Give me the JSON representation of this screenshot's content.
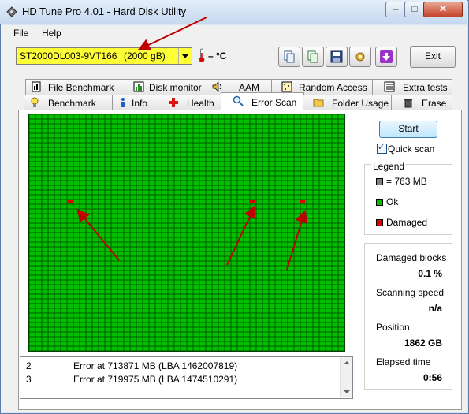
{
  "window": {
    "title": "HD Tune Pro 4.01 - Hard Disk Utility"
  },
  "menu": {
    "file": "File",
    "help": "Help"
  },
  "drive": {
    "name": "ST2000DL003-9VT166",
    "capacity": "(2000 gB)"
  },
  "temperature": "– °C",
  "toolbar": {
    "icons": [
      "copy-icon",
      "copy-all-icon",
      "save-icon",
      "options-icon",
      "download-icon"
    ],
    "exit_label": "Exit"
  },
  "tabs_row1": [
    {
      "label": "File Benchmark",
      "icon": "file-benchmark-icon"
    },
    {
      "label": "Disk monitor",
      "icon": "disk-monitor-icon"
    },
    {
      "label": "AAM",
      "icon": "speaker-icon"
    },
    {
      "label": "Random Access",
      "icon": "random-access-icon"
    },
    {
      "label": "Extra tests",
      "icon": "extra-tests-icon"
    }
  ],
  "tabs_row2": [
    {
      "label": "Benchmark",
      "icon": "bulb-icon"
    },
    {
      "label": "Info",
      "icon": "info-icon"
    },
    {
      "label": "Health",
      "icon": "health-cross-icon"
    },
    {
      "label": "Error Scan",
      "icon": "magnifier-icon",
      "active": true
    },
    {
      "label": "Folder Usage",
      "icon": "folder-icon"
    },
    {
      "label": "Erase",
      "icon": "trash-icon"
    }
  ],
  "scan": {
    "start_label": "Start",
    "quick_scan_label": "Quick scan",
    "quick_scan_checked": true
  },
  "legend": {
    "title": "Legend",
    "block_size": "= 763 MB",
    "ok": "Ok",
    "damaged": "Damaged"
  },
  "stats": {
    "damaged_blocks_label": "Damaged blocks",
    "damaged_blocks_value": "0.1 %",
    "scanning_speed_label": "Scanning speed",
    "scanning_speed_value": "n/a",
    "position_label": "Position",
    "position_value": "1862 GB",
    "elapsed_label": "Elapsed time",
    "elapsed_value": "0:56"
  },
  "log": [
    {
      "num": "2",
      "text": "Error at 713871 MB (LBA 1462007819)"
    },
    {
      "num": "3",
      "text": "Error at 719975 MB (LBA 1474510291)"
    }
  ],
  "colors": {
    "ok": "#00c000",
    "damaged": "#e00000",
    "drive_bg": "#ffff38",
    "arrow": "#c00000"
  }
}
